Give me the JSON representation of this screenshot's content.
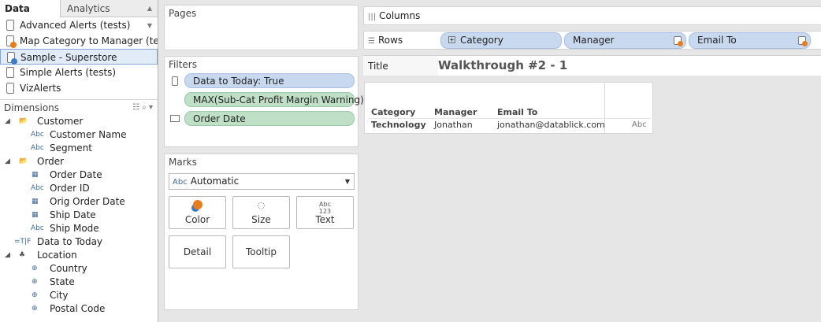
{
  "tabs": {
    "data": "Data",
    "analytics": "Analytics"
  },
  "datasources": [
    {
      "label": "Advanced Alerts (tests)"
    },
    {
      "label": "Map Category to Manager (te..."
    },
    {
      "label": "Sample - Superstore"
    },
    {
      "label": "Simple Alerts (tests)"
    },
    {
      "label": "VizAlerts"
    }
  ],
  "dimensions": {
    "header": "Dimensions",
    "fields": [
      {
        "label": "Customer",
        "type": "folder"
      },
      {
        "label": "Customer Name",
        "type": "Abc"
      },
      {
        "label": "Segment",
        "type": "Abc"
      },
      {
        "label": "Order",
        "type": "folder"
      },
      {
        "label": "Order Date",
        "type": "date"
      },
      {
        "label": "Order ID",
        "type": "Abc"
      },
      {
        "label": "Orig Order Date",
        "type": "date"
      },
      {
        "label": "Ship Date",
        "type": "date"
      },
      {
        "label": "Ship Mode",
        "type": "Abc"
      },
      {
        "label": "Data to Today",
        "type": "T|F"
      },
      {
        "label": "Location",
        "type": "hierarchy"
      },
      {
        "label": "Country",
        "type": "geo"
      },
      {
        "label": "State",
        "type": "geo"
      },
      {
        "label": "City",
        "type": "geo"
      },
      {
        "label": "Postal Code",
        "type": "geo"
      }
    ]
  },
  "pages": {
    "title": "Pages"
  },
  "filters": {
    "title": "Filters",
    "items": [
      "Data to Today: True",
      "MAX(Sub-Cat Profit Margin Warning)",
      "Order Date"
    ]
  },
  "marks": {
    "title": "Marks",
    "type": "Automatic",
    "type_icon": "Abc",
    "buttons": {
      "color": "Color",
      "size": "Size",
      "text": "Text",
      "detail": "Detail",
      "tooltip": "Tooltip"
    },
    "text_icon": "Abc\n123"
  },
  "columns": {
    "label": "Columns"
  },
  "rows": {
    "label": "Rows",
    "pills": [
      "Category",
      "Manager",
      "Email To"
    ]
  },
  "title": {
    "label": "Title",
    "text": "Walkthrough #2 - 1"
  },
  "viz": {
    "headers": [
      "Category",
      "Manager",
      "Email To"
    ],
    "row": [
      "Technology",
      "Jonathan",
      "jonathan@datablick.com",
      "Abc"
    ]
  },
  "colors": {
    "blue_pill": "#c8d9ef",
    "green_pill": "#bfe0c6",
    "alert_badge": "#e87d1e",
    "selected_ds": "#e2ecf8"
  }
}
